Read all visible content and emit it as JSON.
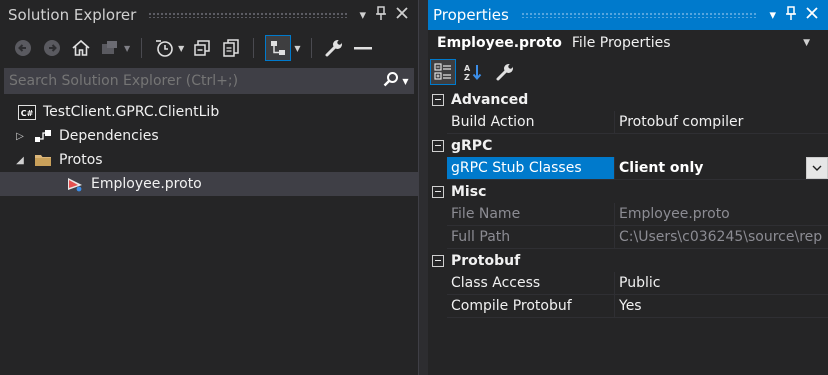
{
  "solution_explorer": {
    "title": "Solution Explorer",
    "search_placeholder": "Search Solution Explorer (Ctrl+;)",
    "toolbar_icons": [
      "back-icon",
      "forward-icon",
      "home-icon",
      "switch-views-icon",
      "pending-changes-filter-icon",
      "collapse-all-icon",
      "show-all-files-icon",
      "sync-active-document-icon",
      "properties-wrench-icon",
      "preview-selected-icon"
    ],
    "tree": [
      {
        "label": "TestClient.GPRC.ClientLib",
        "icon": "csharp-project-icon",
        "expander": "none"
      },
      {
        "label": "Dependencies",
        "icon": "dependencies-icon",
        "expander": "collapsed"
      },
      {
        "label": "Protos",
        "icon": "folder-icon",
        "expander": "expanded"
      },
      {
        "label": "Employee.proto",
        "icon": "proto-file-icon",
        "expander": "none",
        "selected": true
      }
    ]
  },
  "properties": {
    "title": "Properties",
    "object_name": "Employee.proto",
    "object_type": "File Properties",
    "toolbar_icons": [
      "categorized-icon",
      "alphabetical-icon",
      "property-pages-icon"
    ],
    "categories": [
      {
        "name": "Advanced",
        "rows": [
          {
            "name": "Build Action",
            "value": "Protobuf compiler",
            "readonly": false
          }
        ]
      },
      {
        "name": "gRPC",
        "rows": [
          {
            "name": "gRPC Stub Classes",
            "value": "Client only",
            "readonly": false,
            "selected": true,
            "has_dropdown": true
          }
        ]
      },
      {
        "name": "Misc",
        "rows": [
          {
            "name": "File Name",
            "value": "Employee.proto",
            "readonly": true
          },
          {
            "name": "Full Path",
            "value": "C:\\Users\\c036245\\source\\rep",
            "readonly": true
          }
        ]
      },
      {
        "name": "Protobuf",
        "rows": [
          {
            "name": "Class Access",
            "value": "Public",
            "readonly": false
          },
          {
            "name": "Compile Protobuf",
            "value": "Yes",
            "readonly": false
          }
        ]
      }
    ]
  },
  "colors": {
    "accent": "#007acc",
    "panel_bg": "#252526",
    "selection_bg": "#3f3f46"
  }
}
